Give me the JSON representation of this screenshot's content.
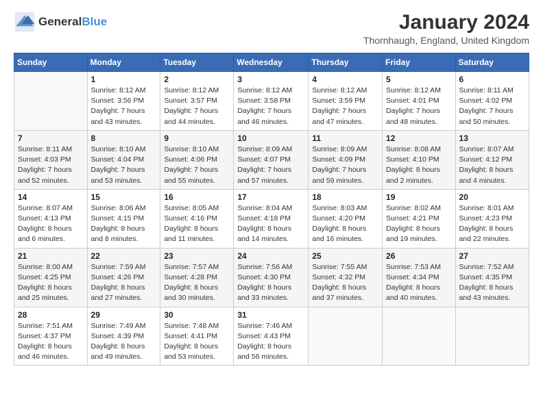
{
  "header": {
    "logo_general": "General",
    "logo_blue": "Blue",
    "title": "January 2024",
    "subtitle": "Thornhaugh, England, United Kingdom"
  },
  "days_of_week": [
    "Sunday",
    "Monday",
    "Tuesday",
    "Wednesday",
    "Thursday",
    "Friday",
    "Saturday"
  ],
  "weeks": [
    [
      {
        "day": "",
        "info": ""
      },
      {
        "day": "1",
        "info": "Sunrise: 8:12 AM\nSunset: 3:56 PM\nDaylight: 7 hours\nand 43 minutes."
      },
      {
        "day": "2",
        "info": "Sunrise: 8:12 AM\nSunset: 3:57 PM\nDaylight: 7 hours\nand 44 minutes."
      },
      {
        "day": "3",
        "info": "Sunrise: 8:12 AM\nSunset: 3:58 PM\nDaylight: 7 hours\nand 46 minutes."
      },
      {
        "day": "4",
        "info": "Sunrise: 8:12 AM\nSunset: 3:59 PM\nDaylight: 7 hours\nand 47 minutes."
      },
      {
        "day": "5",
        "info": "Sunrise: 8:12 AM\nSunset: 4:01 PM\nDaylight: 7 hours\nand 48 minutes."
      },
      {
        "day": "6",
        "info": "Sunrise: 8:11 AM\nSunset: 4:02 PM\nDaylight: 7 hours\nand 50 minutes."
      }
    ],
    [
      {
        "day": "7",
        "info": "Sunrise: 8:11 AM\nSunset: 4:03 PM\nDaylight: 7 hours\nand 52 minutes."
      },
      {
        "day": "8",
        "info": "Sunrise: 8:10 AM\nSunset: 4:04 PM\nDaylight: 7 hours\nand 53 minutes."
      },
      {
        "day": "9",
        "info": "Sunrise: 8:10 AM\nSunset: 4:06 PM\nDaylight: 7 hours\nand 55 minutes."
      },
      {
        "day": "10",
        "info": "Sunrise: 8:09 AM\nSunset: 4:07 PM\nDaylight: 7 hours\nand 57 minutes."
      },
      {
        "day": "11",
        "info": "Sunrise: 8:09 AM\nSunset: 4:09 PM\nDaylight: 7 hours\nand 59 minutes."
      },
      {
        "day": "12",
        "info": "Sunrise: 8:08 AM\nSunset: 4:10 PM\nDaylight: 8 hours\nand 2 minutes."
      },
      {
        "day": "13",
        "info": "Sunrise: 8:07 AM\nSunset: 4:12 PM\nDaylight: 8 hours\nand 4 minutes."
      }
    ],
    [
      {
        "day": "14",
        "info": "Sunrise: 8:07 AM\nSunset: 4:13 PM\nDaylight: 8 hours\nand 6 minutes."
      },
      {
        "day": "15",
        "info": "Sunrise: 8:06 AM\nSunset: 4:15 PM\nDaylight: 8 hours\nand 8 minutes."
      },
      {
        "day": "16",
        "info": "Sunrise: 8:05 AM\nSunset: 4:16 PM\nDaylight: 8 hours\nand 11 minutes."
      },
      {
        "day": "17",
        "info": "Sunrise: 8:04 AM\nSunset: 4:18 PM\nDaylight: 8 hours\nand 14 minutes."
      },
      {
        "day": "18",
        "info": "Sunrise: 8:03 AM\nSunset: 4:20 PM\nDaylight: 8 hours\nand 16 minutes."
      },
      {
        "day": "19",
        "info": "Sunrise: 8:02 AM\nSunset: 4:21 PM\nDaylight: 8 hours\nand 19 minutes."
      },
      {
        "day": "20",
        "info": "Sunrise: 8:01 AM\nSunset: 4:23 PM\nDaylight: 8 hours\nand 22 minutes."
      }
    ],
    [
      {
        "day": "21",
        "info": "Sunrise: 8:00 AM\nSunset: 4:25 PM\nDaylight: 8 hours\nand 25 minutes."
      },
      {
        "day": "22",
        "info": "Sunrise: 7:59 AM\nSunset: 4:26 PM\nDaylight: 8 hours\nand 27 minutes."
      },
      {
        "day": "23",
        "info": "Sunrise: 7:57 AM\nSunset: 4:28 PM\nDaylight: 8 hours\nand 30 minutes."
      },
      {
        "day": "24",
        "info": "Sunrise: 7:56 AM\nSunset: 4:30 PM\nDaylight: 8 hours\nand 33 minutes."
      },
      {
        "day": "25",
        "info": "Sunrise: 7:55 AM\nSunset: 4:32 PM\nDaylight: 8 hours\nand 37 minutes."
      },
      {
        "day": "26",
        "info": "Sunrise: 7:53 AM\nSunset: 4:34 PM\nDaylight: 8 hours\nand 40 minutes."
      },
      {
        "day": "27",
        "info": "Sunrise: 7:52 AM\nSunset: 4:35 PM\nDaylight: 8 hours\nand 43 minutes."
      }
    ],
    [
      {
        "day": "28",
        "info": "Sunrise: 7:51 AM\nSunset: 4:37 PM\nDaylight: 8 hours\nand 46 minutes."
      },
      {
        "day": "29",
        "info": "Sunrise: 7:49 AM\nSunset: 4:39 PM\nDaylight: 8 hours\nand 49 minutes."
      },
      {
        "day": "30",
        "info": "Sunrise: 7:48 AM\nSunset: 4:41 PM\nDaylight: 8 hours\nand 53 minutes."
      },
      {
        "day": "31",
        "info": "Sunrise: 7:46 AM\nSunset: 4:43 PM\nDaylight: 8 hours\nand 56 minutes."
      },
      {
        "day": "",
        "info": ""
      },
      {
        "day": "",
        "info": ""
      },
      {
        "day": "",
        "info": ""
      }
    ]
  ]
}
